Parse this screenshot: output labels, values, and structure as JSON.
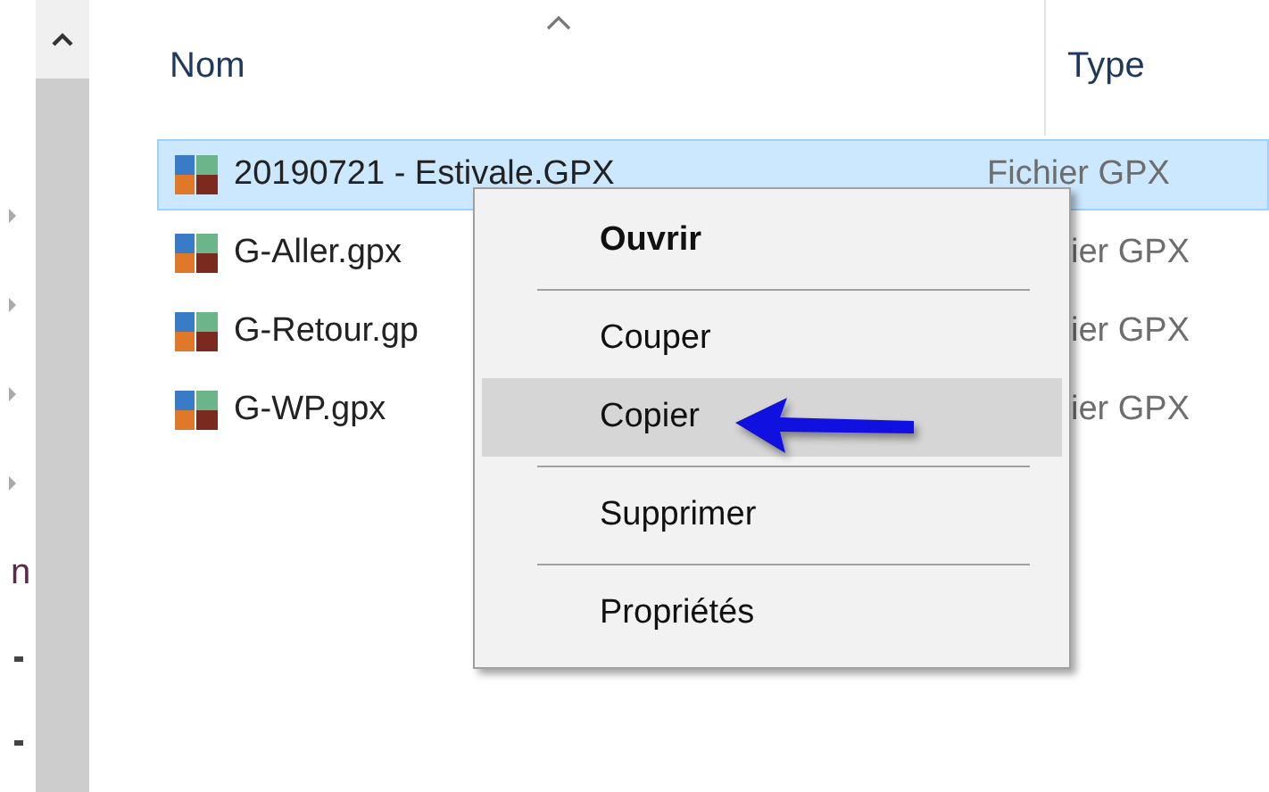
{
  "nav_items": [
    {
      "kind": "expander",
      "expanded": false
    },
    {
      "kind": "expander",
      "expanded": false
    },
    {
      "kind": "expander",
      "expanded": false
    },
    {
      "kind": "expander",
      "expanded": false
    },
    {
      "kind": "text",
      "label": "n"
    },
    {
      "kind": "bullet"
    },
    {
      "kind": "bullet"
    }
  ],
  "columns": [
    {
      "label": "Nom",
      "sorted": true
    },
    {
      "label": "Type",
      "sorted": false
    }
  ],
  "rows": [
    {
      "name": "20190721 - Estivale.GPX",
      "type": "Fichier GPX",
      "selected": true
    },
    {
      "name": "G-Aller.gpx",
      "type": "ier GPX",
      "selected": false
    },
    {
      "name": "G-Retour.gp",
      "type": "ier GPX",
      "selected": false
    },
    {
      "name": "G-WP.gpx",
      "type": "ier GPX",
      "selected": false
    }
  ],
  "context_menu": [
    {
      "kind": "item",
      "label": "Ouvrir",
      "bold": true,
      "selected": false
    },
    {
      "kind": "separator"
    },
    {
      "kind": "item",
      "label": "Couper",
      "bold": false,
      "selected": false
    },
    {
      "kind": "item",
      "label": "Copier",
      "bold": false,
      "selected": true
    },
    {
      "kind": "separator"
    },
    {
      "kind": "item",
      "label": "Supprimer",
      "bold": false,
      "selected": false
    },
    {
      "kind": "separator"
    },
    {
      "kind": "item",
      "label": "Propriétés",
      "bold": false,
      "selected": false
    }
  ]
}
